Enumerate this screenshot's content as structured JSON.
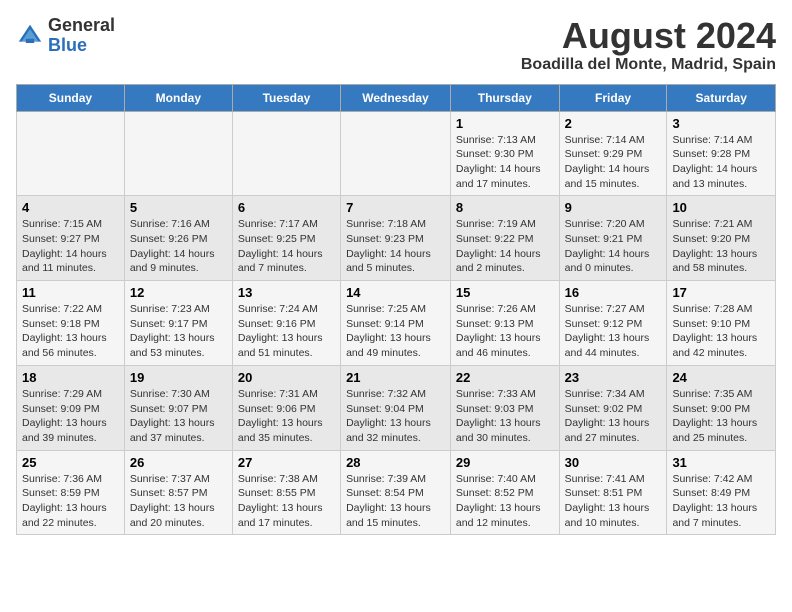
{
  "header": {
    "logo_general": "General",
    "logo_blue": "Blue",
    "title": "August 2024",
    "subtitle": "Boadilla del Monte, Madrid, Spain"
  },
  "weekdays": [
    "Sunday",
    "Monday",
    "Tuesday",
    "Wednesday",
    "Thursday",
    "Friday",
    "Saturday"
  ],
  "weeks": [
    [
      {
        "day": "",
        "info": ""
      },
      {
        "day": "",
        "info": ""
      },
      {
        "day": "",
        "info": ""
      },
      {
        "day": "",
        "info": ""
      },
      {
        "day": "1",
        "info": "Sunrise: 7:13 AM\nSunset: 9:30 PM\nDaylight: 14 hours and 17 minutes."
      },
      {
        "day": "2",
        "info": "Sunrise: 7:14 AM\nSunset: 9:29 PM\nDaylight: 14 hours and 15 minutes."
      },
      {
        "day": "3",
        "info": "Sunrise: 7:14 AM\nSunset: 9:28 PM\nDaylight: 14 hours and 13 minutes."
      }
    ],
    [
      {
        "day": "4",
        "info": "Sunrise: 7:15 AM\nSunset: 9:27 PM\nDaylight: 14 hours and 11 minutes."
      },
      {
        "day": "5",
        "info": "Sunrise: 7:16 AM\nSunset: 9:26 PM\nDaylight: 14 hours and 9 minutes."
      },
      {
        "day": "6",
        "info": "Sunrise: 7:17 AM\nSunset: 9:25 PM\nDaylight: 14 hours and 7 minutes."
      },
      {
        "day": "7",
        "info": "Sunrise: 7:18 AM\nSunset: 9:23 PM\nDaylight: 14 hours and 5 minutes."
      },
      {
        "day": "8",
        "info": "Sunrise: 7:19 AM\nSunset: 9:22 PM\nDaylight: 14 hours and 2 minutes."
      },
      {
        "day": "9",
        "info": "Sunrise: 7:20 AM\nSunset: 9:21 PM\nDaylight: 14 hours and 0 minutes."
      },
      {
        "day": "10",
        "info": "Sunrise: 7:21 AM\nSunset: 9:20 PM\nDaylight: 13 hours and 58 minutes."
      }
    ],
    [
      {
        "day": "11",
        "info": "Sunrise: 7:22 AM\nSunset: 9:18 PM\nDaylight: 13 hours and 56 minutes."
      },
      {
        "day": "12",
        "info": "Sunrise: 7:23 AM\nSunset: 9:17 PM\nDaylight: 13 hours and 53 minutes."
      },
      {
        "day": "13",
        "info": "Sunrise: 7:24 AM\nSunset: 9:16 PM\nDaylight: 13 hours and 51 minutes."
      },
      {
        "day": "14",
        "info": "Sunrise: 7:25 AM\nSunset: 9:14 PM\nDaylight: 13 hours and 49 minutes."
      },
      {
        "day": "15",
        "info": "Sunrise: 7:26 AM\nSunset: 9:13 PM\nDaylight: 13 hours and 46 minutes."
      },
      {
        "day": "16",
        "info": "Sunrise: 7:27 AM\nSunset: 9:12 PM\nDaylight: 13 hours and 44 minutes."
      },
      {
        "day": "17",
        "info": "Sunrise: 7:28 AM\nSunset: 9:10 PM\nDaylight: 13 hours and 42 minutes."
      }
    ],
    [
      {
        "day": "18",
        "info": "Sunrise: 7:29 AM\nSunset: 9:09 PM\nDaylight: 13 hours and 39 minutes."
      },
      {
        "day": "19",
        "info": "Sunrise: 7:30 AM\nSunset: 9:07 PM\nDaylight: 13 hours and 37 minutes."
      },
      {
        "day": "20",
        "info": "Sunrise: 7:31 AM\nSunset: 9:06 PM\nDaylight: 13 hours and 35 minutes."
      },
      {
        "day": "21",
        "info": "Sunrise: 7:32 AM\nSunset: 9:04 PM\nDaylight: 13 hours and 32 minutes."
      },
      {
        "day": "22",
        "info": "Sunrise: 7:33 AM\nSunset: 9:03 PM\nDaylight: 13 hours and 30 minutes."
      },
      {
        "day": "23",
        "info": "Sunrise: 7:34 AM\nSunset: 9:02 PM\nDaylight: 13 hours and 27 minutes."
      },
      {
        "day": "24",
        "info": "Sunrise: 7:35 AM\nSunset: 9:00 PM\nDaylight: 13 hours and 25 minutes."
      }
    ],
    [
      {
        "day": "25",
        "info": "Sunrise: 7:36 AM\nSunset: 8:59 PM\nDaylight: 13 hours and 22 minutes."
      },
      {
        "day": "26",
        "info": "Sunrise: 7:37 AM\nSunset: 8:57 PM\nDaylight: 13 hours and 20 minutes."
      },
      {
        "day": "27",
        "info": "Sunrise: 7:38 AM\nSunset: 8:55 PM\nDaylight: 13 hours and 17 minutes."
      },
      {
        "day": "28",
        "info": "Sunrise: 7:39 AM\nSunset: 8:54 PM\nDaylight: 13 hours and 15 minutes."
      },
      {
        "day": "29",
        "info": "Sunrise: 7:40 AM\nSunset: 8:52 PM\nDaylight: 13 hours and 12 minutes."
      },
      {
        "day": "30",
        "info": "Sunrise: 7:41 AM\nSunset: 8:51 PM\nDaylight: 13 hours and 10 minutes."
      },
      {
        "day": "31",
        "info": "Sunrise: 7:42 AM\nSunset: 8:49 PM\nDaylight: 13 hours and 7 minutes."
      }
    ]
  ]
}
